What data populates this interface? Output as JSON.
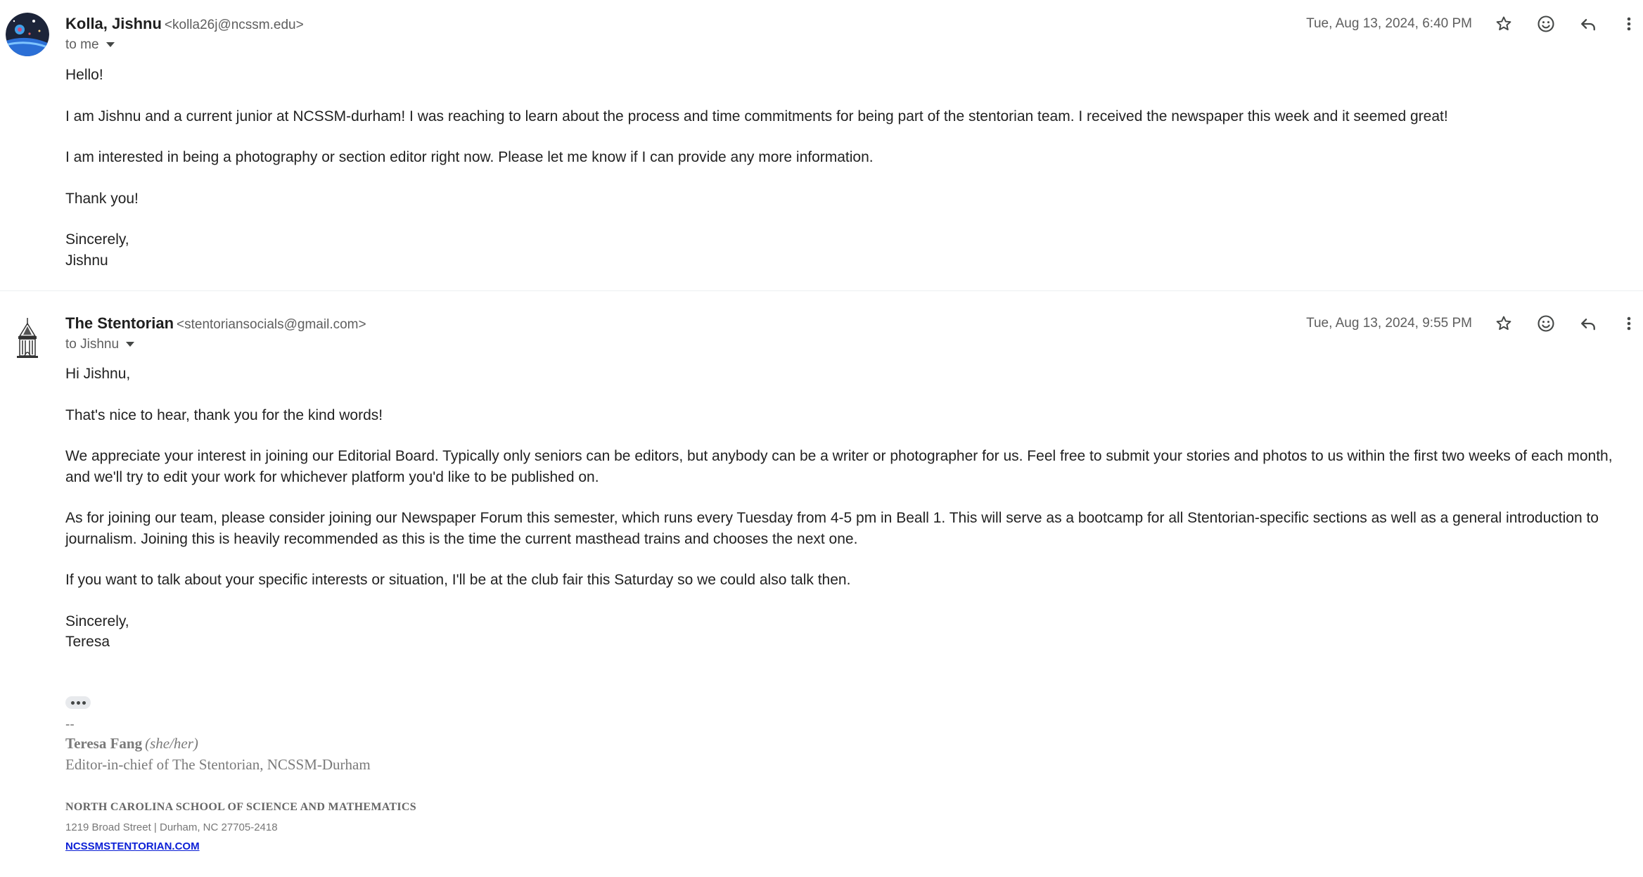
{
  "messages": [
    {
      "sender_name": "Kolla, Jishnu",
      "sender_email": "<kolla26j@ncssm.edu>",
      "recipient": "to me",
      "date": "Tue, Aug 13, 2024, 6:40 PM",
      "avatar_icon": "space-planet-avatar",
      "body": [
        "Hello!",
        "I am Jishnu and a current junior at NCSSM-durham! I was reaching to learn about the process and time commitments for being part of the stentorian team. I received the newspaper this week and it seemed great!",
        "I am interested in being a photography or section editor right now. Please let me know if I can provide any more information.",
        "Thank you!",
        "Sincerely,",
        "Jishnu"
      ]
    },
    {
      "sender_name": "The Stentorian",
      "sender_email": "<stentoriansocials@gmail.com>",
      "recipient": "to Jishnu",
      "date": "Tue, Aug 13, 2024, 9:55 PM",
      "avatar_icon": "tower-logo",
      "body": [
        "Hi Jishnu,",
        "That's nice to hear, thank you for the kind words!",
        "We appreciate your interest in joining our Editorial Board. Typically only seniors can be editors, but anybody can be a writer or photographer for us. Feel free to submit your stories and photos to us within the first two weeks of each month, and we'll try to edit your work for whichever platform you'd like to be published on.",
        "As for joining our team, please consider joining our Newspaper Forum this semester, which runs every Tuesday from 4-5 pm in Beall 1. This will serve as a bootcamp for all Stentorian-specific sections as well as a general introduction to journalism. Joining this is heavily recommended as this is the time the current masthead trains and chooses the next one.",
        "If you want to talk about your specific interests or situation, I'll be at the club fair this Saturday so we could also talk then.",
        "Sincerely,",
        "Teresa"
      ],
      "signature": {
        "dash": "--",
        "name": "Teresa Fang",
        "pronouns": "(she/her)",
        "title": "Editor-in-chief of The Stentorian, NCSSM-Durham",
        "school": "NORTH CAROLINA SCHOOL OF SCIENCE AND MATHEMATICS",
        "address": "1219 Broad Street | Durham, NC 27705-2418",
        "link": "NCSSMSTENTORIAN.COM"
      }
    }
  ],
  "icons": {
    "star": "star-icon",
    "emoji": "emoji-react-icon",
    "reply": "reply-icon",
    "more": "more-vert-icon",
    "recipient_caret": "chevron-down-icon",
    "show_trimmed": "ellipsis-icon"
  },
  "colors": {
    "text_primary": "#1f1f1f",
    "text_secondary": "#5e5e5e",
    "link": "#0b1fd6",
    "divider": "#eceff1"
  }
}
